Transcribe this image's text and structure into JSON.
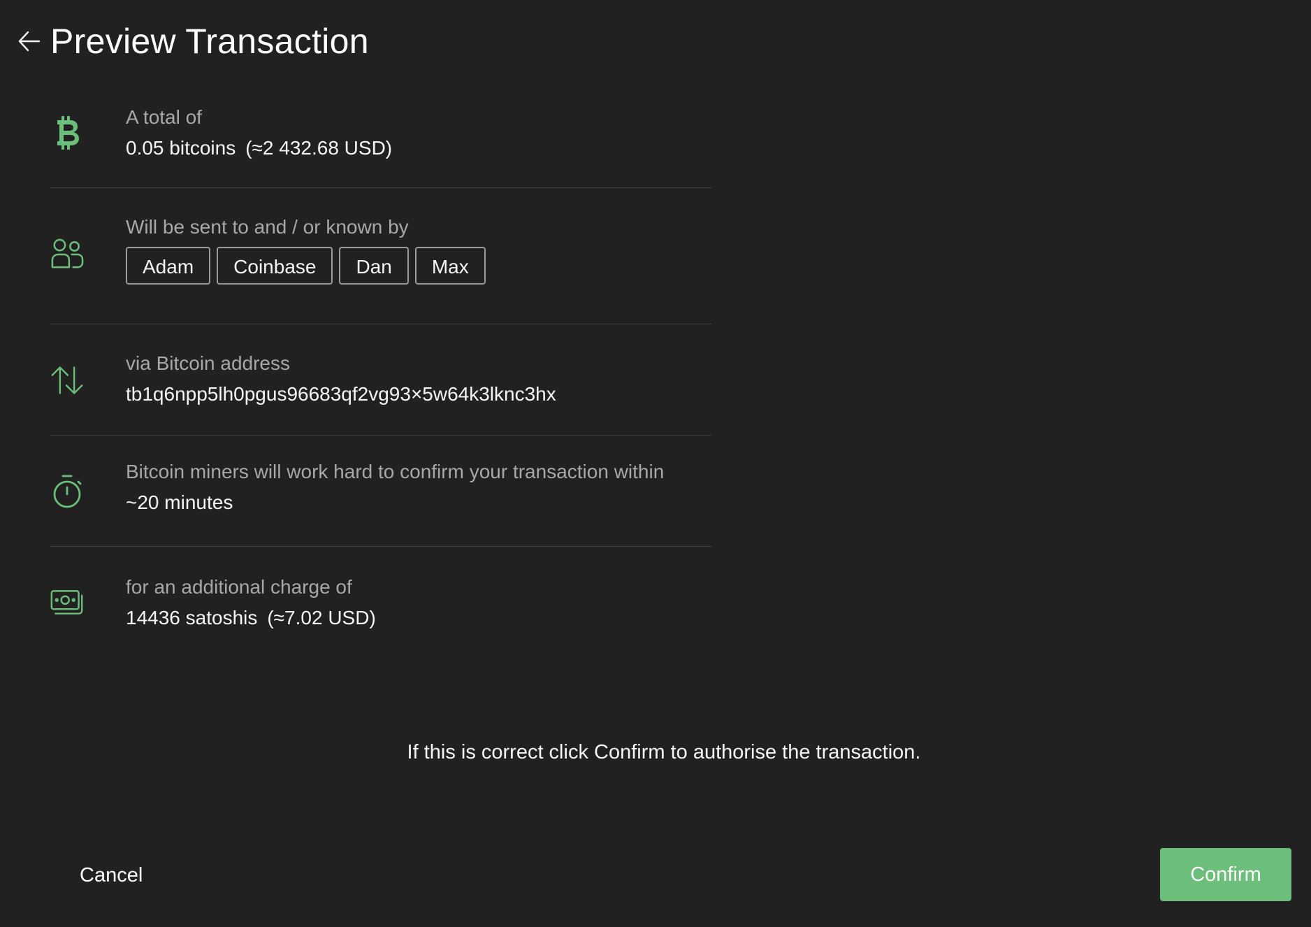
{
  "header": {
    "back_icon": "arrow-left-icon",
    "title": "Preview Transaction"
  },
  "summary": {
    "amount": {
      "icon": "bitcoin-icon",
      "label": "A total of",
      "value": "0.05 bitcoins",
      "fiat": "(≈2 432.68 USD)"
    },
    "recipients": {
      "icon": "people-icon",
      "label": "Will be sent to and / or known by",
      "contacts": [
        "Adam",
        "Coinbase",
        "Dan",
        "Max"
      ]
    },
    "address": {
      "icon": "arrows-up-down-icon",
      "label": "via Bitcoin address",
      "value": "tb1q6npp5lh0pgus96683qf2vg93×5w64k3lknc3hx"
    },
    "timing": {
      "icon": "stopwatch-icon",
      "label": "Bitcoin miners will work hard to confirm your transaction within",
      "value": "~20 minutes"
    },
    "fee": {
      "icon": "cash-icon",
      "label": "for an additional charge of",
      "value": "14436 satoshis",
      "fiat": "(≈7.02 USD)"
    }
  },
  "notice": "If this is correct click Confirm to authorise the transaction.",
  "actions": {
    "cancel_label": "Cancel",
    "confirm_label": "Confirm"
  },
  "colors": {
    "background": "#212121",
    "accent": "#6cbf7b",
    "divider": "#444444",
    "muted_text": "#a8a8a8"
  }
}
